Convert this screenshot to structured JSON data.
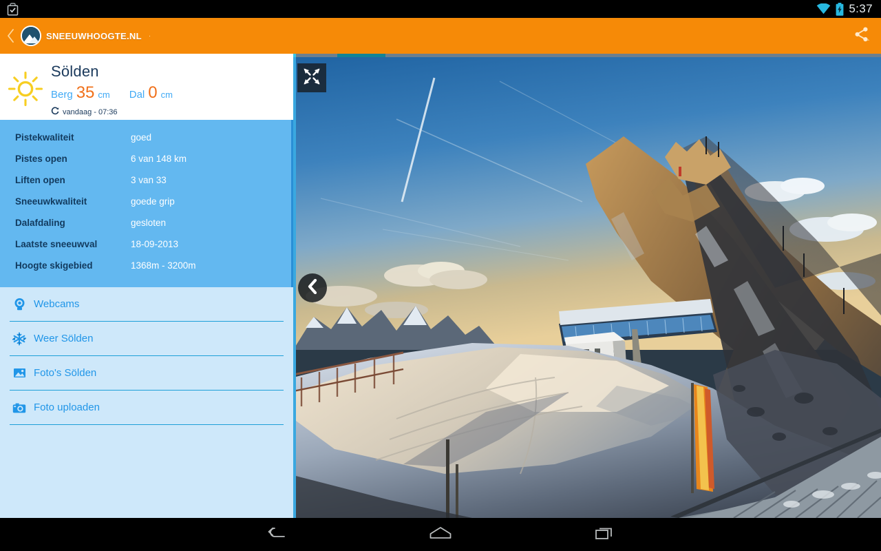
{
  "statusbar": {
    "clock": "5:37",
    "icons": [
      "checkin-bag-icon",
      "wifi-icon",
      "battery-charging-icon"
    ]
  },
  "appbar": {
    "back_icon": "chevron-left-icon",
    "logo_text": "SNEEUWHOOGTE.NL",
    "logo_dot": "·",
    "share_icon": "share-icon",
    "background_color": "#F68A07"
  },
  "resort": {
    "weather_icon": "sun-icon",
    "name": "Sölden",
    "berg_label": "Berg",
    "berg_value": "35",
    "berg_unit": "cm",
    "dal_label": "Dal",
    "dal_value": "0",
    "dal_unit": "cm",
    "refresh_icon": "refresh-icon",
    "updated": "vandaag - 07:36"
  },
  "details": {
    "panel_color": "#63B8F0",
    "rows": [
      {
        "label": "Pistekwaliteit",
        "value": "goed"
      },
      {
        "label": "Pistes open",
        "value": "6 van 148 km"
      },
      {
        "label": "Liften open",
        "value": "3 van 33"
      },
      {
        "label": "Sneeuwkwaliteit",
        "value": "goede grip"
      },
      {
        "label": "Dalafdaling",
        "value": "gesloten"
      },
      {
        "label": "Laatste sneeuwval",
        "value": "18-09-2013"
      },
      {
        "label": "Hoogte skigebied",
        "value": "1368m - 3200m"
      }
    ]
  },
  "menu": {
    "accent_color": "#2196E8",
    "items": [
      {
        "label": "Webcams",
        "icon": "webcam-icon"
      },
      {
        "label": "Weer Sölden",
        "icon": "snowflake-icon"
      },
      {
        "label": "Foto's Sölden",
        "icon": "photo-icon"
      },
      {
        "label": "Foto uploaden",
        "icon": "camera-icon"
      }
    ]
  },
  "viewer": {
    "collapse_icon": "collapse-fullscreen-icon",
    "prev_icon": "chevron-left-icon",
    "progress_color": "#138496",
    "photo_description": "Besneeuwde bergtop bij zonsopgang met bergstation"
  },
  "navbar": {
    "back_icon": "android-back-icon",
    "home_icon": "android-home-icon",
    "recents_icon": "android-recents-icon"
  }
}
